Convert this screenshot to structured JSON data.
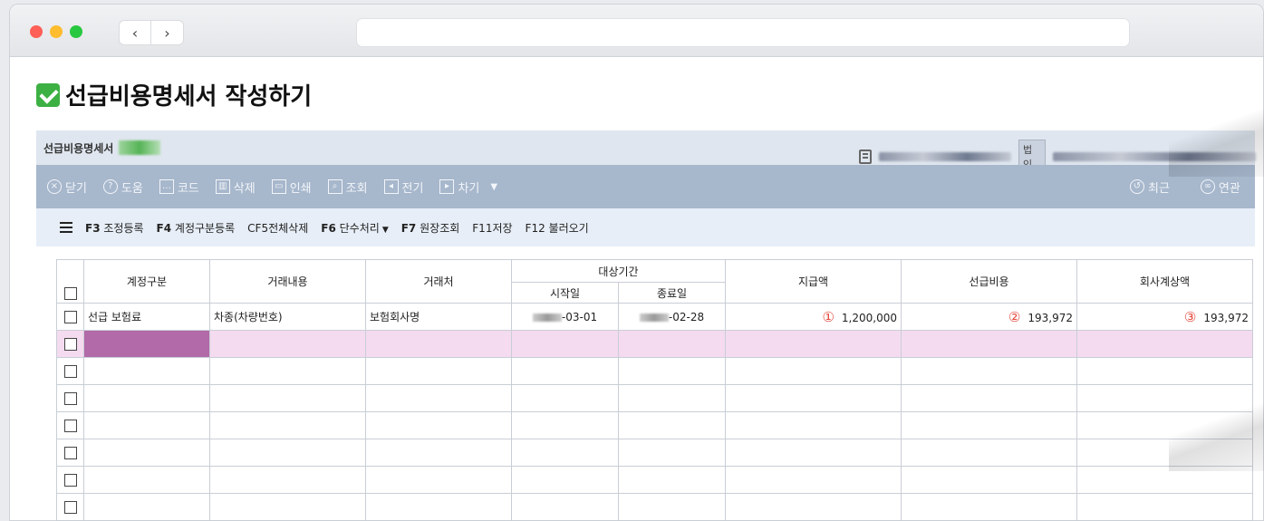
{
  "page": {
    "title": "선급비용명세서 작성하기"
  },
  "panel": {
    "title": "선급비용명세서",
    "corp_label": "법인"
  },
  "toolbar": {
    "items": [
      {
        "icon": "close-icon",
        "label": "닫기"
      },
      {
        "icon": "help-icon",
        "label": "도움"
      },
      {
        "icon": "code-icon",
        "label": "코드"
      },
      {
        "icon": "trash-icon",
        "label": "삭제"
      },
      {
        "icon": "print-icon",
        "label": "인쇄"
      },
      {
        "icon": "search-icon",
        "label": "조회"
      },
      {
        "icon": "transfer-icon",
        "label": "전기"
      },
      {
        "icon": "next-icon",
        "label": "차기"
      }
    ],
    "right": [
      {
        "icon": "history-icon",
        "label": "최근"
      },
      {
        "icon": "link-icon",
        "label": "연관"
      }
    ]
  },
  "fkeys": [
    {
      "key": "F3",
      "label": "조정등록"
    },
    {
      "key": "F4",
      "label": "계정구분등록"
    },
    {
      "key": "CF5",
      "label": "전체삭제"
    },
    {
      "key": "F6",
      "label": "단수처리"
    },
    {
      "key": "F7",
      "label": "원장조회"
    },
    {
      "key": "F11",
      "label": "저장"
    },
    {
      "key": "F12",
      "label": "불러오기"
    }
  ],
  "table": {
    "headers": {
      "account_type": "계정구분",
      "description": "거래내용",
      "vendor": "거래처",
      "period": "대상기간",
      "start_date": "시작일",
      "end_date": "종료일",
      "payment": "지급액",
      "prepaid": "선급비용",
      "company_amount": "회사계상액"
    },
    "row1": {
      "account_type": "선급 보험료",
      "description": "차종(차량번호)",
      "vendor": "보험회사명",
      "start_date": "-03-01",
      "end_date": "-02-28",
      "payment_mark": "①",
      "payment": "1,200,000",
      "prepaid_mark": "②",
      "prepaid": "193,972",
      "company_mark": "③",
      "company_amount": "193,972"
    }
  }
}
